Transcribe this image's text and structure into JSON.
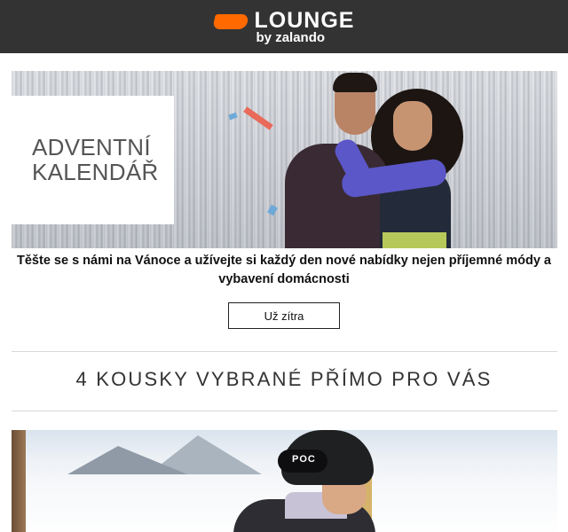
{
  "header": {
    "logo_main": "LOUNGE",
    "logo_sub": "by zalando",
    "brand_color": "#ff6900",
    "background_color": "#333333"
  },
  "hero": {
    "title_line1": "ADVENTNÍ",
    "title_line2": "KALENDÁŘ"
  },
  "intro": {
    "text": "Těšte se s námi na Vánoce a užívejte si každý den nové nabídky nejen příjemné módy a vybavení domácnosti"
  },
  "cta": {
    "label": "Už zítra"
  },
  "section": {
    "title": "4 KOUSKY VYBRANÉ PŘÍMO PRO VÁS"
  },
  "product": {
    "helmet_brand": "POC"
  }
}
